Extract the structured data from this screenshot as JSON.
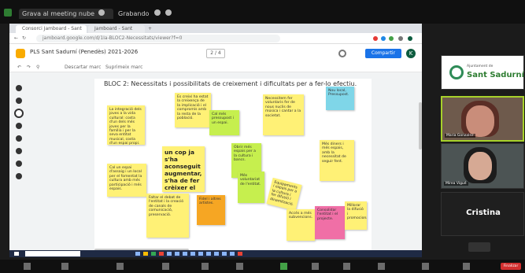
{
  "meeting": {
    "topbar": {
      "tab1": "Grava al meeting nube",
      "tab2": "Grabando..."
    },
    "participants": [
      {
        "label": "Ajuntament de",
        "name": "Sant Sadurní"
      },
      {
        "label": "Maria Gonzalez"
      },
      {
        "label": "Mirea Vigué"
      }
    ],
    "speaker": "Cristina",
    "end_label": "Finalizar"
  },
  "browser": {
    "tabs": [
      {
        "label": "Consorci Jamboard - Sant"
      },
      {
        "label": "Jamboard - Sant"
      }
    ],
    "url": "jamboard.google.com/d/1Ia-BLOC2-Necessitats/viewer?f=0"
  },
  "jamboard": {
    "title": "PLS Sant Sadurní (Penedès) 2021-2026",
    "frame_counter": "2 / 4",
    "share_label": "Compartir",
    "avatar_letter": "K",
    "toolbar": [
      "Descartar marc",
      "Suprimeix marc"
    ],
    "canvas_title": "BLOC 2: Necessitats i possibilitats de creixement i dificultats per a fer-lo efectiu.",
    "notes": [
      {
        "text": "La integració dels joves a la vida cultural: costa d'un dels més joves per la família i per la seva entitat musical, costa d'un espai propi."
      },
      {
        "text": "Es creixí ha estat la creixença de la implicació i el compromís amb la resta de la població."
      },
      {
        "text": "Cal més pressupost i un espai."
      },
      {
        "text": "Necessitem fer voluntaris fer de nous nuclis de música i cantar a la societat."
      },
      {
        "text": "Nou local, Pressupost."
      },
      {
        "text": "Obrir més espais per a la cultura i bancs."
      },
      {
        "text": "Cal un espai d'assaig i un local per el fomentat la cultura amb més participació i més espais."
      },
      {
        "text": "un cop ja s'ha aconseguit augmentar, s'ha de fer crèixer el grup."
      },
      {
        "text": "Més diners i més espais, amb la necessitat de seguir fent."
      },
      {
        "text": "Faltar el debat de l'entitat i la creació de canals de comunicació, preservació."
      },
      {
        "text": "Fidel i altres artistes."
      },
      {
        "text": "Més voluntariat de l'entitat."
      },
      {
        "text": "Equipaments i espais per a la cultura i fer difusió i dinamització."
      },
      {
        "text": "Accés a més subvencions."
      },
      {
        "text": "Consolidar l'entitat i el projecte."
      },
      {
        "text": "Millorar la difusió i promocionar."
      }
    ]
  }
}
